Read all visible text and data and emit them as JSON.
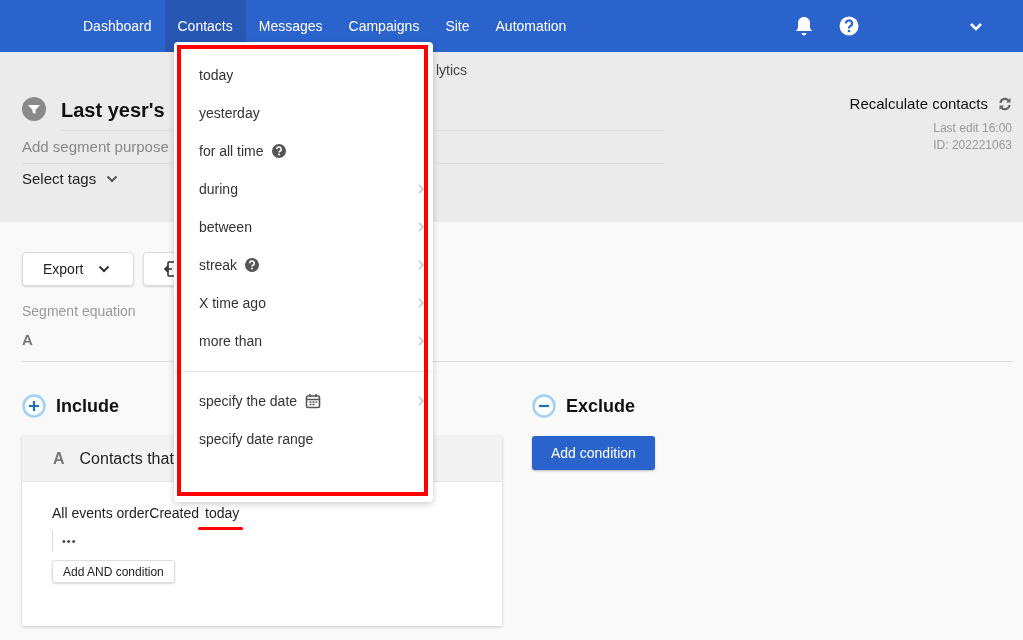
{
  "nav": {
    "items": [
      {
        "label": "Dashboard",
        "selected": false
      },
      {
        "label": "Contacts",
        "selected": true
      },
      {
        "label": "Messages",
        "selected": false
      },
      {
        "label": "Campaigns",
        "selected": false
      },
      {
        "label": "Site",
        "selected": false
      },
      {
        "label": "Automation",
        "selected": false
      }
    ]
  },
  "breadcrumb_fragment": "lytics",
  "header": {
    "title": "Last yesr's",
    "purpose_placeholder": "Add segment purpose",
    "tags": "Select tags",
    "recalculate": "Recalculate contacts",
    "last_edit": "Last edit 16:00",
    "id": "ID:  202221063"
  },
  "toolbar": {
    "export": "Export"
  },
  "equation": {
    "label": "Segment equation",
    "value": "A"
  },
  "include": {
    "title": "Include",
    "group": {
      "letter": "A",
      "title": "Contacts that",
      "condition": "All events orderCreated",
      "value": "today",
      "more": "•••",
      "add_button": "Add AND condition"
    }
  },
  "exclude": {
    "title": "Exclude",
    "add_button": "Add condition"
  },
  "dropdown": {
    "groups": [
      [
        {
          "label": "today",
          "help": false,
          "submenu": false,
          "calendar": false
        },
        {
          "label": "yesterday",
          "help": false,
          "submenu": false,
          "calendar": false
        },
        {
          "label": "for all time",
          "help": true,
          "submenu": false,
          "calendar": false
        },
        {
          "label": "during",
          "help": false,
          "submenu": true,
          "calendar": false
        },
        {
          "label": "between",
          "help": false,
          "submenu": true,
          "calendar": false
        },
        {
          "label": "streak",
          "help": true,
          "submenu": true,
          "calendar": false
        },
        {
          "label": "X time ago",
          "help": false,
          "submenu": true,
          "calendar": false
        },
        {
          "label": "more than",
          "help": false,
          "submenu": true,
          "calendar": false
        }
      ],
      [
        {
          "label": "specify the date",
          "help": false,
          "submenu": true,
          "calendar": true
        },
        {
          "label": "specify date range",
          "help": false,
          "submenu": false,
          "calendar": false
        }
      ]
    ]
  }
}
